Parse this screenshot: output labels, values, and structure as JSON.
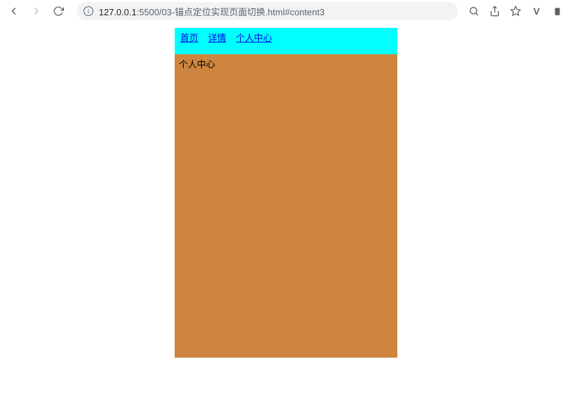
{
  "browser": {
    "url_host": "127.0.0.1",
    "url_port": ":5500",
    "url_path": "/03-锚点定位实现页面切换.html#content3",
    "info_glyph": "i"
  },
  "page": {
    "nav": {
      "items": [
        {
          "label": "首页"
        },
        {
          "label": "详情"
        },
        {
          "label": "个人中心"
        }
      ]
    },
    "content": {
      "title": "个人中心"
    }
  }
}
